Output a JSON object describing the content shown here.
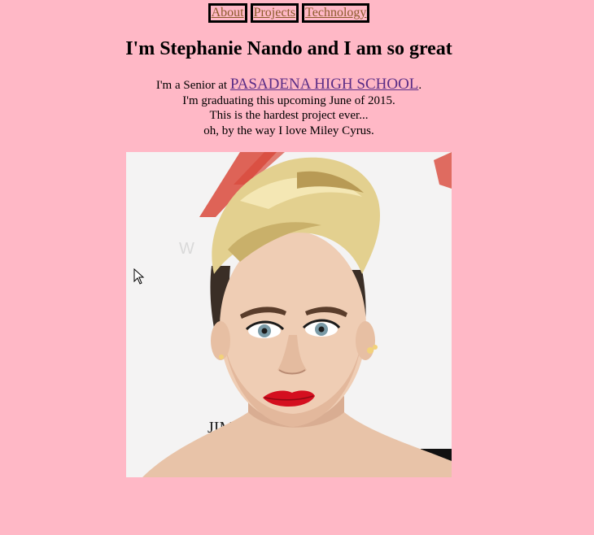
{
  "nav": {
    "items": [
      {
        "label": "About"
      },
      {
        "label": "Projects"
      },
      {
        "label": "Technology"
      }
    ]
  },
  "header": {
    "title": "I'm Stephanie Nando and I am so great"
  },
  "intro": {
    "line1_prefix": "I'm a Senior at ",
    "school_link": "PASADENA HIGH SCHOOL",
    "line1_suffix": ".",
    "line2": "I'm graduating this upcoming June of 2015.",
    "line3": "This is the hardest project ever...",
    "line4": "oh, by the way I love Miley Cyrus."
  },
  "photo": {
    "backdrop_text": "JIM BE"
  },
  "colors": {
    "background": "#ffb8c6",
    "nav_link": "#8b5a2b",
    "school_link": "#5b2d86",
    "lips": "#d40f1f"
  }
}
